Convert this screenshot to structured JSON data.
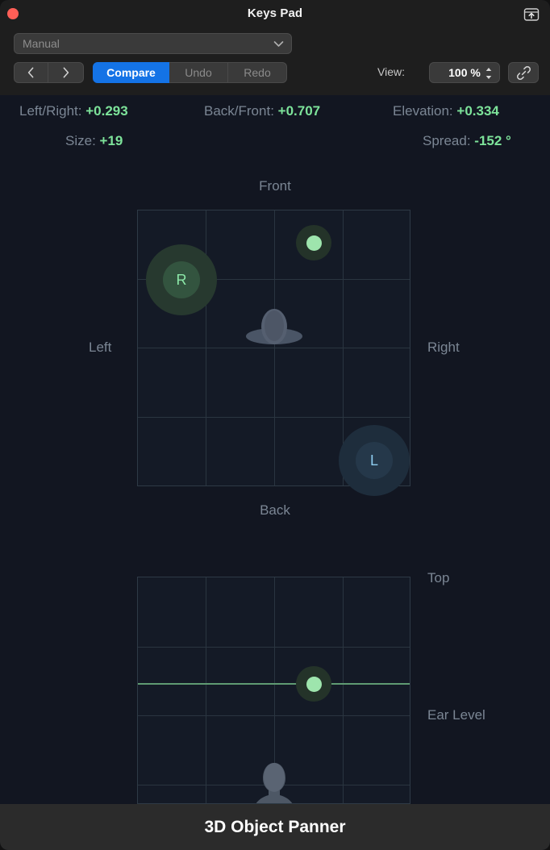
{
  "window": {
    "title": "Keys Pad",
    "close_icon": "close-button",
    "share_icon": "share-export-icon"
  },
  "toolbar": {
    "preset": {
      "value": "Manual",
      "chevron_icon": "chevron-down-icon"
    },
    "nav": {
      "prev_icon": "chevron-left-icon",
      "next_icon": "chevron-right-icon"
    },
    "compare_label": "Compare",
    "undo_label": "Undo",
    "redo_label": "Redo",
    "view_label": "View:",
    "view_value": "100 %",
    "stepper_icon": "stepper-up-down-icon",
    "link_icon": "link-chain-icon"
  },
  "readouts": [
    {
      "key": "Left/Right:",
      "value": "+0.293"
    },
    {
      "key": "Back/Front:",
      "value": "+0.707"
    },
    {
      "key": "Elevation:",
      "value": "+0.334"
    },
    {
      "key": "Size:",
      "value": "+19"
    },
    {
      "key": "Spread:",
      "value": "-152 °"
    }
  ],
  "top_view": {
    "label_front": "Front",
    "label_back": "Back",
    "label_left": "Left",
    "label_right": "Right",
    "speaker_r": "R",
    "speaker_l": "L",
    "listener_icon": "head-top-view-icon",
    "object_icon": "object-position-dot"
  },
  "side_view": {
    "label_top": "Top",
    "label_ear_level": "Ear Level",
    "listener_icon": "head-front-view-icon",
    "object_icon": "object-position-dot",
    "elevation_line": "elevation-reference-line"
  },
  "footer": {
    "title": "3D Object Panner"
  },
  "colors": {
    "accent_blue": "#1473e6",
    "value_green": "#7de39a",
    "object_green": "#9ee5ad",
    "speaker_blue": "#8ecdf0",
    "label_gray": "#7b8694",
    "panel_bg": "#121621",
    "chrome_bg": "#1e1e1e",
    "footer_bg": "#2b2b2b",
    "close_red": "#ff5f57"
  }
}
